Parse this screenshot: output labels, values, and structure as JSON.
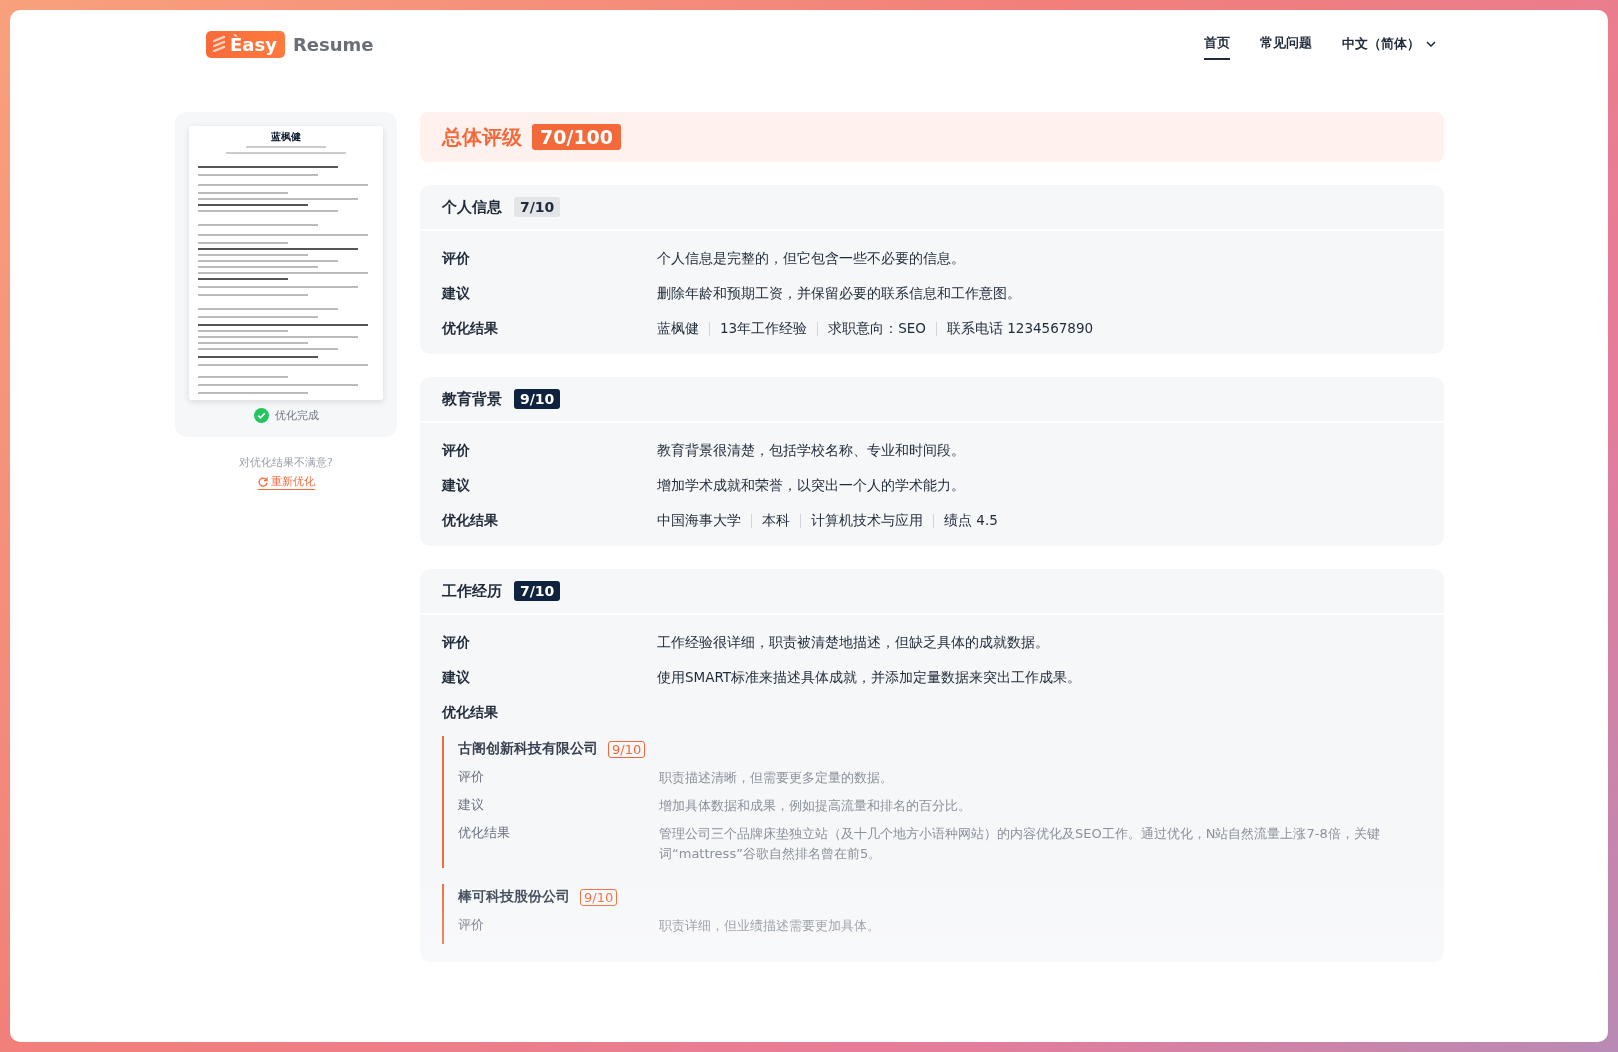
{
  "header": {
    "logo": {
      "badge": "Èasy",
      "text": "Resume"
    },
    "nav": [
      {
        "label": "首页",
        "selected": true
      },
      {
        "label": "常见问题",
        "selected": false
      }
    ],
    "language": "中文（简体）"
  },
  "sidebar": {
    "thumbnail_name": "蓝枫健",
    "status": "优化完成",
    "prompt": "对优化结果不满意?",
    "retry": "重新优化"
  },
  "overall": {
    "label": "总体评级",
    "score": "70/100"
  },
  "sections": [
    {
      "title": "个人信息",
      "score": "7/10",
      "highlighted": false,
      "rows": [
        {
          "label": "评价",
          "text": "个人信息是完整的，但它包含一些不必要的信息。"
        },
        {
          "label": "建议",
          "text": "删除年龄和预期工资，并保留必要的联系信息和工作意图。"
        }
      ],
      "result": {
        "label": "优化结果",
        "items": [
          "蓝枫健",
          "13年工作经验",
          "求职意向：SEO",
          "联系电话 1234567890"
        ]
      }
    },
    {
      "title": "教育背景",
      "score": "9/10",
      "highlighted": true,
      "rows": [
        {
          "label": "评价",
          "text": "教育背景很清楚，包括学校名称、专业和时间段。"
        },
        {
          "label": "建议",
          "text": "增加学术成就和荣誉，以突出一个人的学术能力。"
        }
      ],
      "result": {
        "label": "优化结果",
        "items": [
          "中国海事大学",
          "本科",
          "计算机技术与应用",
          "绩点 4.5"
        ]
      }
    },
    {
      "title": "工作经历",
      "score": "7/10",
      "highlighted": true,
      "rows": [
        {
          "label": "评价",
          "text": "工作经验很详细，职责被清楚地描述，但缺乏具体的成就数据。"
        },
        {
          "label": "建议",
          "text": "使用SMART标准来描述具体成就，并添加定量数据来突出工作成果。"
        }
      ],
      "result": {
        "label": "优化结果",
        "companies": [
          {
            "name": "古阁创新科技有限公司",
            "score": "9/10",
            "rows": [
              {
                "label": "评价",
                "text": "职责描述清晰，但需要更多定量的数据。"
              },
              {
                "label": "建议",
                "text": "增加具体数据和成果，例如提高流量和排名的百分比。"
              },
              {
                "label": "优化结果",
                "text": "管理公司三个品牌床垫独立站（及十几个地方小语种网站）的内容优化及SEO工作。通过优化，N站自然流量上涨7-8倍，关键词“mattress”谷歌自然排名曾在前5。"
              }
            ]
          },
          {
            "name": "棒可科技股份公司",
            "score": "9/10",
            "rows": [
              {
                "label": "评价",
                "text": "职责详细，但业绩描述需要更加具体。"
              }
            ]
          }
        ]
      }
    }
  ]
}
